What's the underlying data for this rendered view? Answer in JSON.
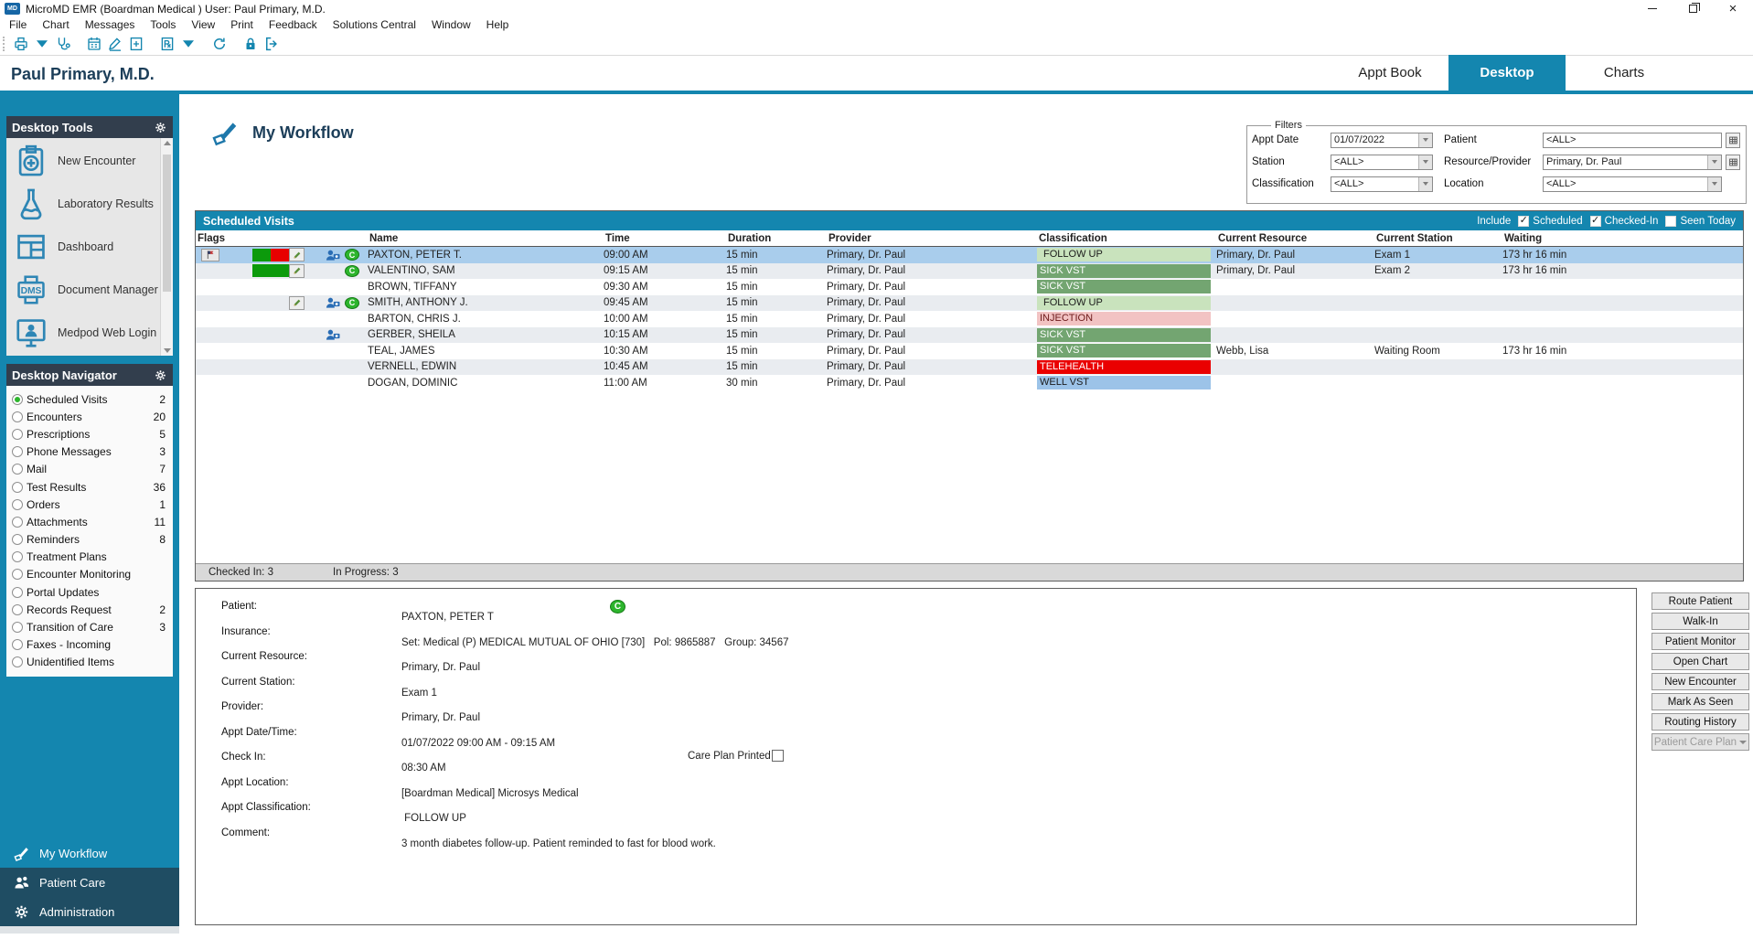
{
  "theme": {
    "teal": "#1486af",
    "panel_header": "#323e4d",
    "navy_text": "#1c3e59",
    "selected_row": "#a9cdec",
    "alt_row": "#e9ecf0",
    "badge_green": "#2db52d",
    "cls_followup": "#c9e3bd",
    "cls_sick": "#73a571",
    "cls_injection": "#f2c3c3",
    "cls_telehealth": "#ea0000",
    "cls_well": "#9cc3e8"
  },
  "window": {
    "title": "MicroMD EMR (Boardman Medical )  User: Paul Primary, M.D.",
    "logo_text": "MD"
  },
  "menu_items": [
    {
      "label": "File"
    },
    {
      "label": "Chart"
    },
    {
      "label": "Messages"
    },
    {
      "label": "Tools"
    },
    {
      "label": "View"
    },
    {
      "label": "Print"
    },
    {
      "label": "Feedback"
    },
    {
      "label": "Solutions Central"
    },
    {
      "label": "Window"
    },
    {
      "label": "Help"
    }
  ],
  "toolbar_items": [
    {
      "icon": "printer"
    },
    {
      "icon": "arrow-down"
    },
    {
      "icon": "stethoscope"
    },
    {
      "sep": true
    },
    {
      "icon": "calendar"
    },
    {
      "icon": "signature"
    },
    {
      "icon": "doc-add"
    },
    {
      "sep": true
    },
    {
      "icon": "rx-doc"
    },
    {
      "icon": "arrow-down"
    },
    {
      "sep": true
    },
    {
      "icon": "refresh"
    },
    {
      "sep": true
    },
    {
      "icon": "lock"
    },
    {
      "icon": "logout"
    }
  ],
  "header": {
    "user_name": "Paul Primary, M.D.",
    "tabs": [
      {
        "label": "Appt Book",
        "active": false
      },
      {
        "label": "Desktop",
        "active": true
      },
      {
        "label": "Charts",
        "active": false
      }
    ]
  },
  "desktop_tools": {
    "title": "Desktop Tools",
    "items": [
      {
        "label": "New Encounter",
        "icon": "clipboard-plus"
      },
      {
        "label": "Laboratory Results",
        "icon": "flask"
      },
      {
        "label": "Dashboard",
        "icon": "dashboard"
      },
      {
        "label": "Document Manager",
        "icon": "dms"
      },
      {
        "label": "Medpod Web Login",
        "icon": "medpod"
      }
    ]
  },
  "desktop_navigator": {
    "title": "Desktop Navigator",
    "items": [
      {
        "label": "Scheduled Visits",
        "count": "2",
        "selected": true
      },
      {
        "label": "Encounters",
        "count": "20"
      },
      {
        "label": "Prescriptions",
        "count": "5"
      },
      {
        "label": "Phone Messages",
        "count": "3"
      },
      {
        "label": "Mail",
        "count": "7"
      },
      {
        "label": "Test Results",
        "count": "36"
      },
      {
        "label": "Orders",
        "count": "1"
      },
      {
        "label": "Attachments",
        "count": "11"
      },
      {
        "label": "Reminders",
        "count": "8"
      },
      {
        "label": "Treatment Plans",
        "count": ""
      },
      {
        "label": "Encounter Monitoring",
        "count": ""
      },
      {
        "label": "Portal Updates",
        "count": ""
      },
      {
        "label": "Records Request",
        "count": "2"
      },
      {
        "label": "Transition of Care",
        "count": "3"
      },
      {
        "label": "Faxes - Incoming",
        "count": ""
      },
      {
        "label": "Unidentified Items",
        "count": ""
      }
    ]
  },
  "bottom_nav": [
    {
      "label": "My Workflow",
      "icon": "workflow",
      "active": true
    },
    {
      "label": "Patient Care",
      "icon": "people"
    },
    {
      "label": "Administration",
      "icon": "gear"
    }
  ],
  "workflow": {
    "title": "My Workflow"
  },
  "filters": {
    "legend": "Filters",
    "appt_date": {
      "label": "Appt Date",
      "value": "01/07/2022"
    },
    "patient": {
      "label": "Patient",
      "value": "<ALL>"
    },
    "station": {
      "label": "Station",
      "value": "<ALL>"
    },
    "resource": {
      "label": "Resource/Provider",
      "value": "Primary, Dr. Paul"
    },
    "classification": {
      "label": "Classification",
      "value": "<ALL>"
    },
    "location": {
      "label": "Location",
      "value": "<ALL>"
    }
  },
  "visits": {
    "title": "Scheduled Visits",
    "include_label": "Include",
    "include_options": [
      {
        "label": "Scheduled",
        "checked": true,
        "mark": "✓"
      },
      {
        "label": "Checked-In",
        "checked": true,
        "mark": "✓"
      },
      {
        "label": "Seen Today",
        "checked": false,
        "mark": ""
      }
    ],
    "columns": [
      "Flags",
      "Name",
      "Time",
      "Duration",
      "Provider",
      "Classification",
      "Current Resource",
      "Current Station",
      "Waiting"
    ],
    "rows": [
      {
        "stripe": "selected",
        "flags": {
          "flag": true,
          "status_green": true,
          "status_red": true,
          "note": true,
          "photo": true,
          "badge": "C"
        },
        "name": "PAXTON, PETER T.",
        "time": "09:00 AM",
        "duration": "15 min",
        "provider": "Primary, Dr. Paul",
        "cls": "FOLLOW UP",
        "cls_style": "followup",
        "resource": "Primary, Dr. Paul",
        "station": "Exam 1",
        "waiting": "173 hr 16 min"
      },
      {
        "stripe": "alt",
        "flags": {
          "status_green": true,
          "note": true,
          "badge": "C"
        },
        "name": "VALENTINO, SAM",
        "time": "09:15 AM",
        "duration": "15 min",
        "provider": "Primary, Dr. Paul",
        "cls": "SICK VST",
        "cls_style": "sick",
        "resource": "Primary, Dr. Paul",
        "station": "Exam 2",
        "waiting": "173 hr 16 min"
      },
      {
        "stripe": "",
        "flags": {},
        "name": "BROWN, TIFFANY",
        "time": "09:30 AM",
        "duration": "15 min",
        "provider": "Primary, Dr. Paul",
        "cls": "SICK VST",
        "cls_style": "sick",
        "resource": "",
        "station": "",
        "waiting": ""
      },
      {
        "stripe": "alt",
        "flags": {
          "note": true,
          "photo": true,
          "badge": "C"
        },
        "name": "SMITH, ANTHONY J.",
        "time": "09:45 AM",
        "duration": "15 min",
        "provider": "Primary, Dr. Paul",
        "cls": "FOLLOW UP",
        "cls_style": "followup",
        "resource": "",
        "station": "",
        "waiting": ""
      },
      {
        "stripe": "",
        "flags": {},
        "name": "BARTON, CHRIS J.",
        "time": "10:00 AM",
        "duration": "15 min",
        "provider": "Primary, Dr. Paul",
        "cls": "INJECTION",
        "cls_style": "injection",
        "resource": "",
        "station": "",
        "waiting": ""
      },
      {
        "stripe": "alt",
        "flags": {
          "photo": true
        },
        "name": "GERBER, SHEILA",
        "time": "10:15 AM",
        "duration": "15 min",
        "provider": "Primary, Dr. Paul",
        "cls": "SICK VST",
        "cls_style": "sick",
        "resource": "",
        "station": "",
        "waiting": ""
      },
      {
        "stripe": "",
        "flags": {},
        "name": "TEAL, JAMES",
        "time": "10:30 AM",
        "duration": "15 min",
        "provider": "Primary, Dr. Paul",
        "cls": "SICK VST",
        "cls_style": "sick",
        "resource": "Webb,  Lisa",
        "station": "Waiting Room",
        "waiting": "173 hr 16 min"
      },
      {
        "stripe": "alt",
        "flags": {},
        "name": "VERNELL, EDWIN",
        "time": "10:45 AM",
        "duration": "15 min",
        "provider": "Primary, Dr. Paul",
        "cls": "TELEHEALTH",
        "cls_style": "telehealth",
        "resource": "",
        "station": "",
        "waiting": ""
      },
      {
        "stripe": "",
        "flags": {},
        "name": "DOGAN, DOMINIC",
        "time": "11:00 AM",
        "duration": "30 min",
        "provider": "Primary, Dr. Paul",
        "cls": "WELL VST",
        "cls_style": "well",
        "resource": "",
        "station": "",
        "waiting": ""
      }
    ],
    "status_left": "Checked In: 3",
    "status_right": "In Progress: 3"
  },
  "detail": {
    "rows": [
      {
        "label": "Patient:",
        "value": "PAXTON, PETER T",
        "badge": "C"
      },
      {
        "label": "Insurance:",
        "value": "Set: Medical (P) MEDICAL MUTUAL OF OHIO [730]   Pol: 9865887   Group: 34567"
      },
      {
        "label": "Current Resource:",
        "value": "Primary, Dr. Paul"
      },
      {
        "label": "Current Station:",
        "value": "Exam 1"
      },
      {
        "label": "Provider:",
        "value": "Primary, Dr. Paul"
      },
      {
        "label": "Appt Date/Time:",
        "value": "01/07/2022 09:00 AM - 09:15 AM"
      },
      {
        "label": "Check In:",
        "value": "08:30 AM",
        "extra": "Care Plan Printed"
      },
      {
        "label": "Appt Location:",
        "value": "[Boardman Medical] Microsys Medical"
      },
      {
        "label": "Appt Classification:",
        "value": " FOLLOW UP"
      },
      {
        "label": "Comment:",
        "value": "3 month diabetes follow-up. Patient reminded to fast for blood work."
      }
    ]
  },
  "actions": [
    {
      "label": "Route Patient"
    },
    {
      "label": "Walk-In"
    },
    {
      "label": "Patient Monitor"
    },
    {
      "label": "Open Chart"
    },
    {
      "label": "New Encounter"
    },
    {
      "label": "Mark As Seen"
    },
    {
      "label": "Routing History"
    },
    {
      "label": "Patient Care Plan",
      "state": "disabled",
      "dropdown": true
    }
  ]
}
